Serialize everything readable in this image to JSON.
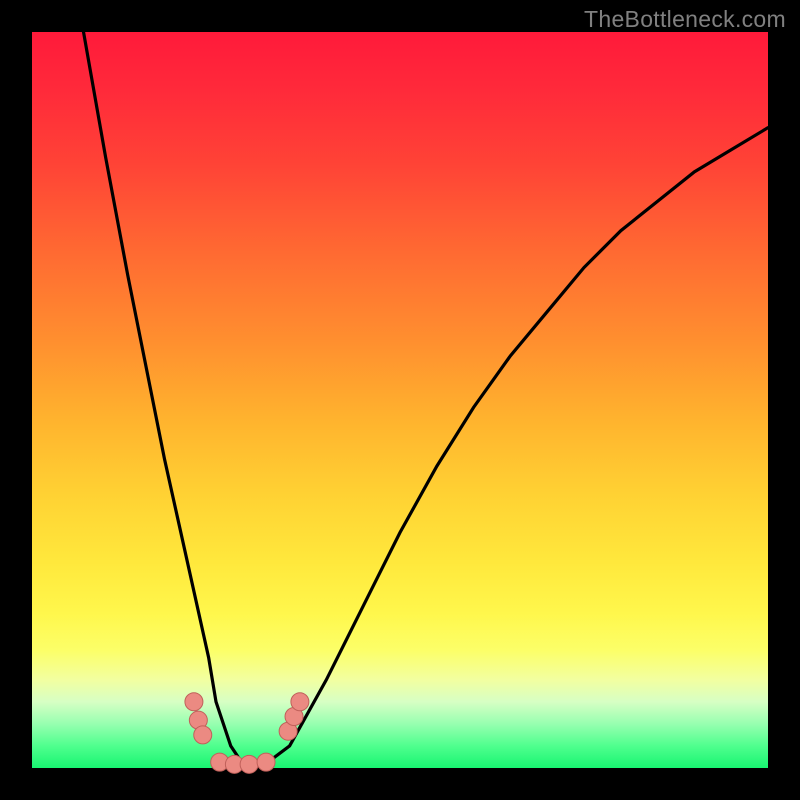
{
  "watermark": "TheBottleneck.com",
  "colors": {
    "frame": "#000000",
    "gradient_top": "#ff1a3a",
    "gradient_bottom": "#18f571",
    "curve_stroke": "#000000",
    "marker_fill": "#eb8a82",
    "marker_stroke": "#c0605a"
  },
  "chart_data": {
    "type": "line",
    "title": "",
    "xlabel": "",
    "ylabel": "",
    "xlim": [
      0,
      100
    ],
    "ylim": [
      0,
      100
    ],
    "series": [
      {
        "name": "bottleneck-curve",
        "x": [
          7,
          10,
          13,
          16,
          18,
          20,
          22,
          24,
          25,
          27,
          29,
          31,
          35,
          40,
          45,
          50,
          55,
          60,
          65,
          70,
          75,
          80,
          85,
          90,
          95,
          100
        ],
        "y": [
          100,
          83,
          67,
          52,
          42,
          33,
          24,
          15,
          9,
          3,
          0,
          0,
          3,
          12,
          22,
          32,
          41,
          49,
          56,
          62,
          68,
          73,
          77,
          81,
          84,
          87
        ]
      }
    ],
    "markers": [
      {
        "x": 22.0,
        "y": 9.0
      },
      {
        "x": 22.6,
        "y": 6.5
      },
      {
        "x": 23.2,
        "y": 4.5
      },
      {
        "x": 25.5,
        "y": 0.8
      },
      {
        "x": 27.5,
        "y": 0.5
      },
      {
        "x": 29.5,
        "y": 0.5
      },
      {
        "x": 31.8,
        "y": 0.8
      },
      {
        "x": 34.8,
        "y": 5.0
      },
      {
        "x": 35.6,
        "y": 7.0
      },
      {
        "x": 36.4,
        "y": 9.0
      }
    ]
  }
}
